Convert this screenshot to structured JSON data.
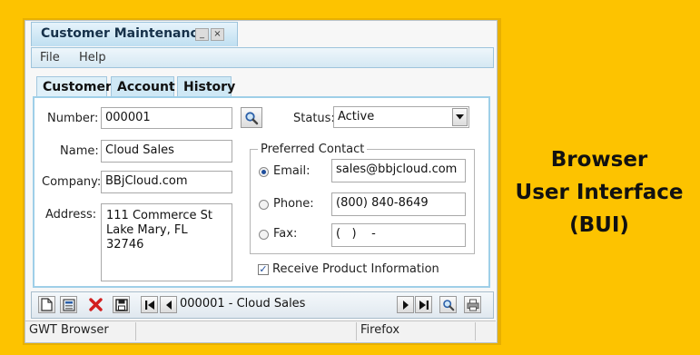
{
  "window": {
    "title": "Customer Maintenance",
    "minimize_glyph": "_",
    "close_glyph": "×"
  },
  "menu": [
    "File",
    "Help"
  ],
  "tabs": [
    {
      "label": "Customer",
      "active": true
    },
    {
      "label": "Account",
      "active": false
    },
    {
      "label": "History",
      "active": false
    }
  ],
  "form": {
    "number_label": "Number:",
    "number_value": "000001",
    "status_label": "Status:",
    "status_value": "Active",
    "name_label": "Name:",
    "name_value": "Cloud Sales",
    "company_label": "Company:",
    "company_value": "BBjCloud.com",
    "address_label": "Address:",
    "address_lines": [
      "111 Commerce St",
      "Lake Mary, FL",
      "32746"
    ]
  },
  "preferred_contact": {
    "title": "Preferred Contact",
    "email_label": "Email:",
    "email_value": "sales@bbjcloud.com",
    "phone_label": "Phone:",
    "phone_value": "(800) 840-8649",
    "fax_label": "Fax:",
    "fax_value": "(   )    -",
    "selected": "email"
  },
  "receive_info": {
    "label": "Receive Product Information",
    "checked": true
  },
  "navigator": {
    "record_text": "000001 - Cloud Sales"
  },
  "statusbar": {
    "left": "GWT Browser",
    "right": "Firefox"
  },
  "headline": {
    "lines": [
      "Browser",
      "User Interface",
      "(BUI)"
    ]
  },
  "colors": {
    "background": "#fdc300",
    "accent": "#1f4e9c",
    "delete": "#d22020"
  },
  "icons": [
    "new-document-icon",
    "save-form-icon",
    "delete-icon",
    "floppy-icon",
    "first-record-icon",
    "prev-record-icon",
    "next-record-icon",
    "last-record-icon",
    "search-icon",
    "print-icon",
    "dropdown-arrow-icon"
  ]
}
